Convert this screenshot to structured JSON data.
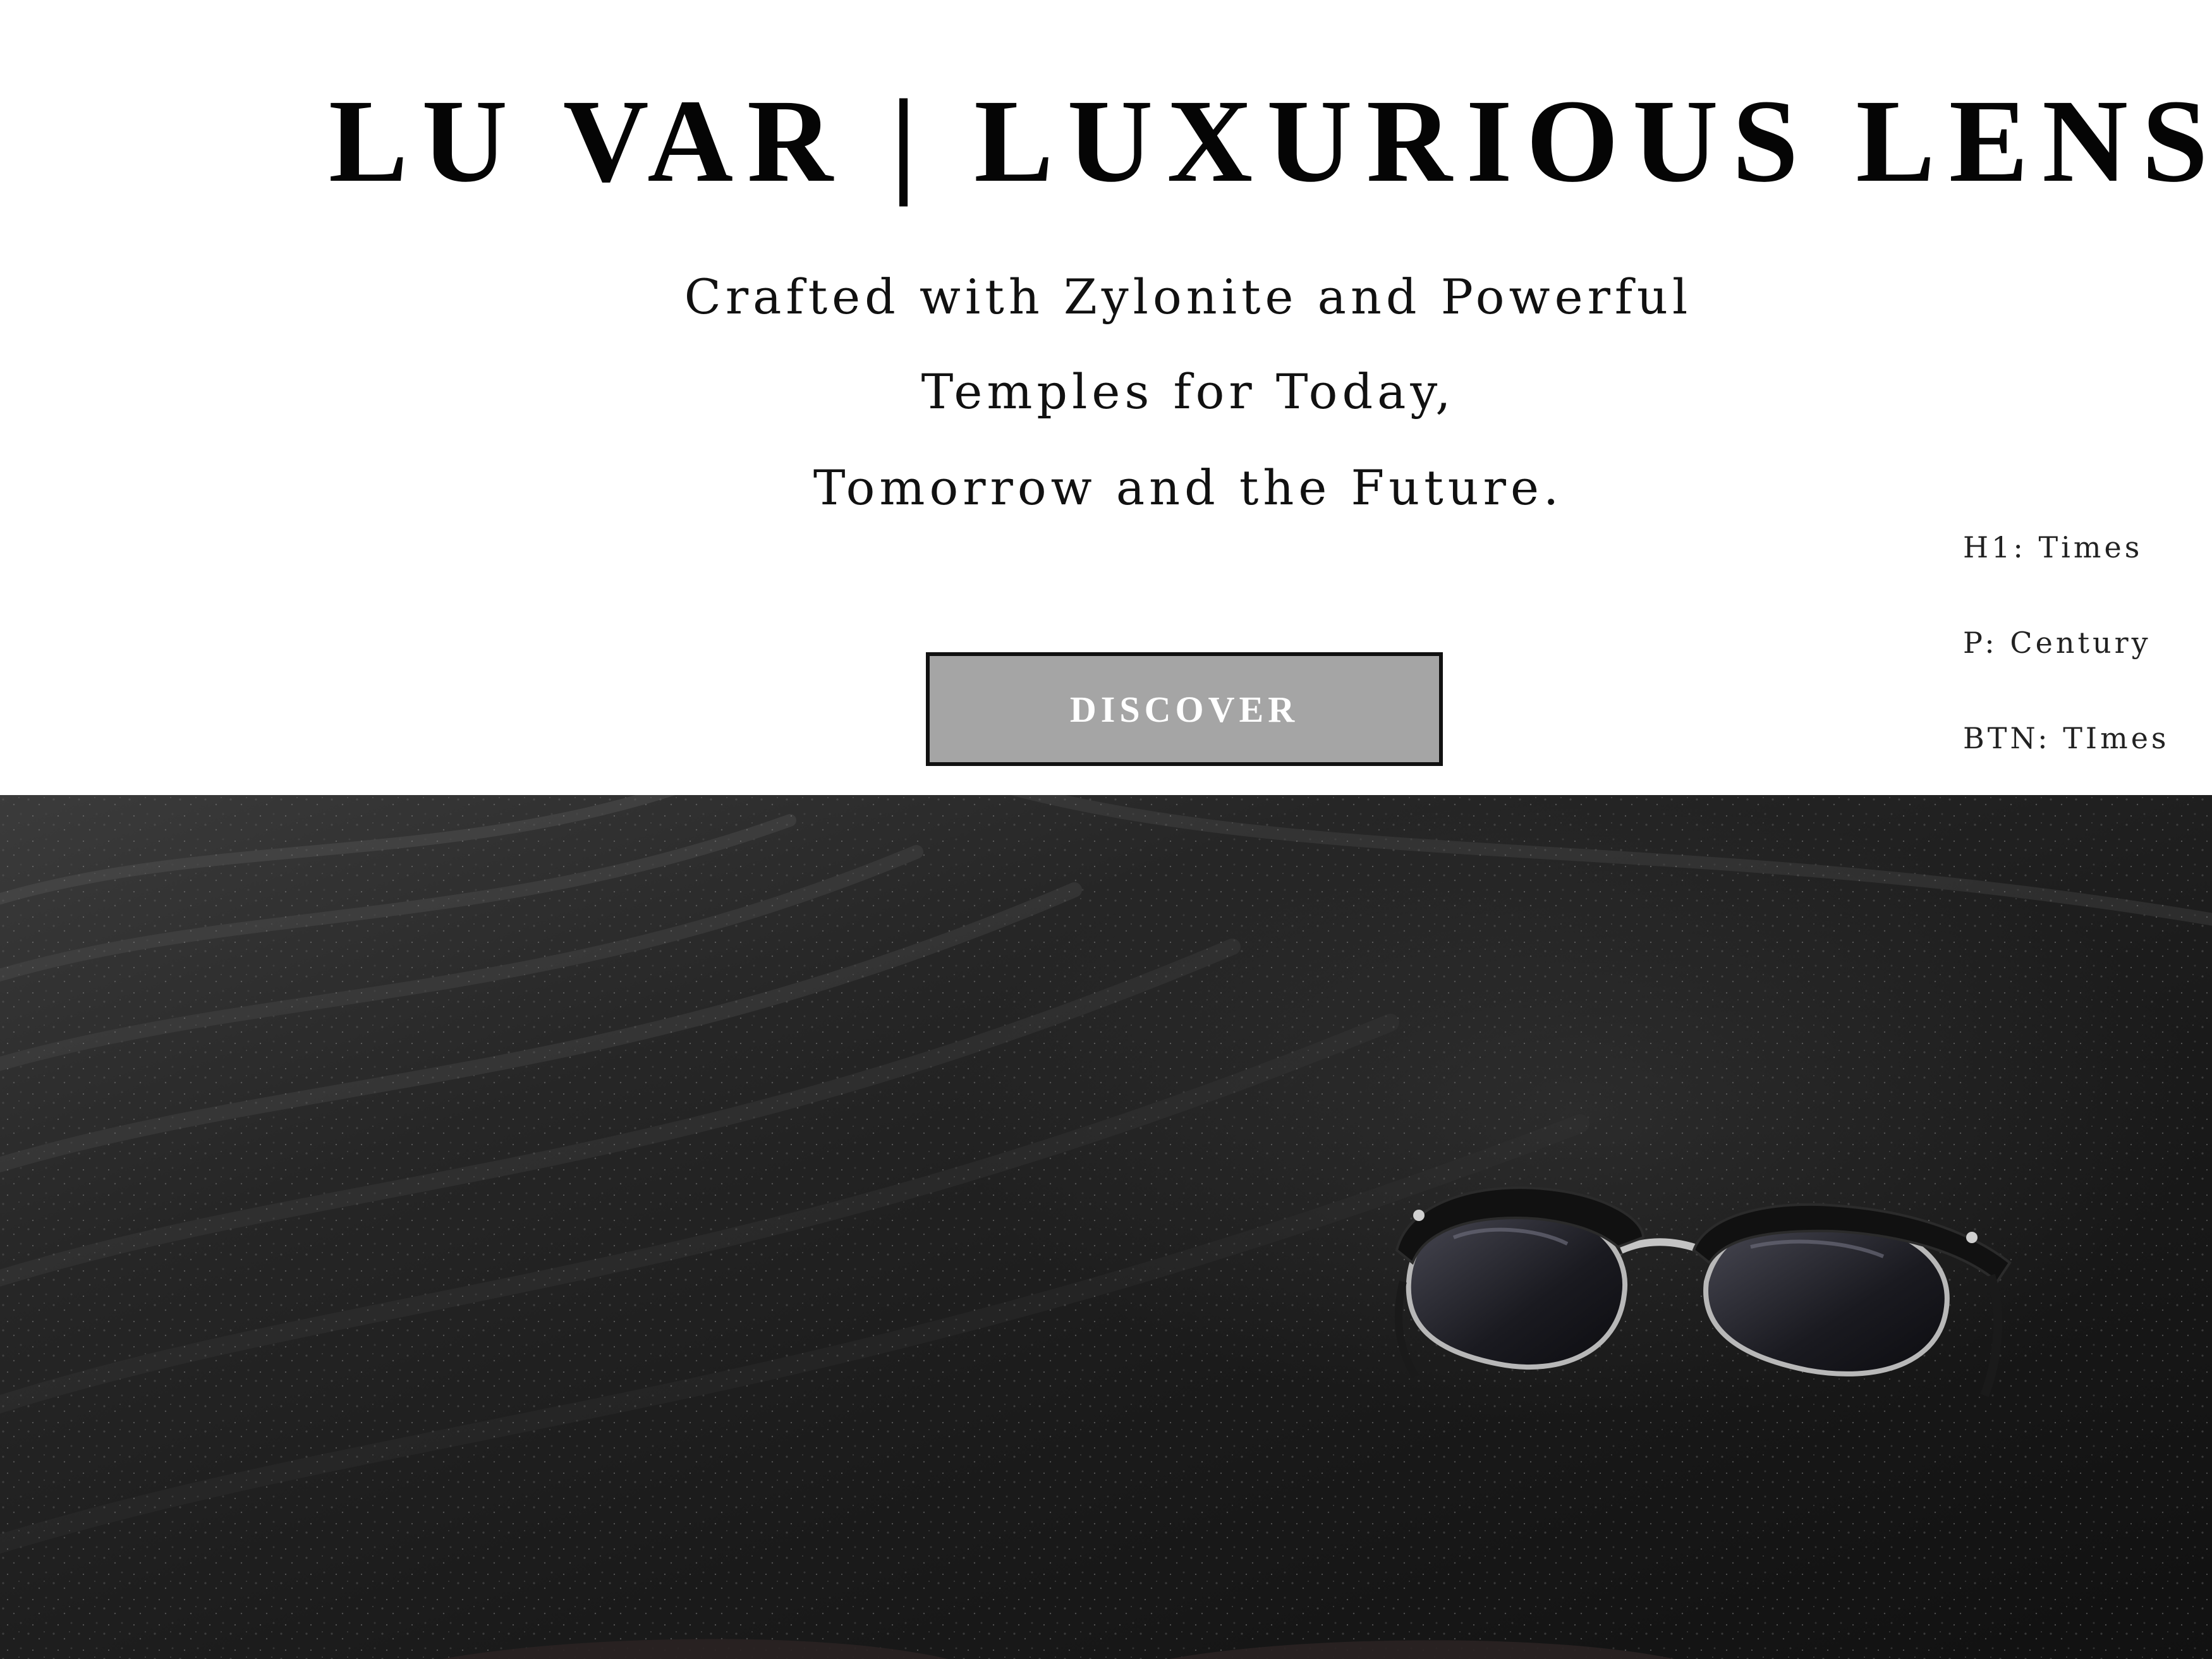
{
  "header": {
    "title": "LU VAR | LUXURIOUS LENS",
    "tagline_lines": [
      "Crafted with Zylonite and Powerful",
      "Temples for Today,",
      "Tomorrow and the Future."
    ],
    "cta_label": "DISCOVER"
  },
  "font_notes": [
    "H1: Times",
    "P: Century",
    "BTN: TImes"
  ],
  "hero": {
    "icon": "sunglasses-on-black-sand",
    "sand_color": "#1c1c1c",
    "button_color": "#a5a5a5"
  }
}
